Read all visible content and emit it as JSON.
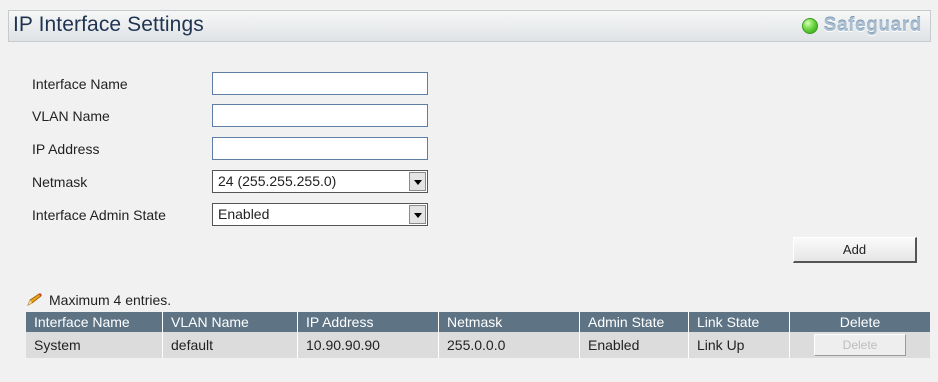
{
  "header": {
    "title": "IP Interface Settings",
    "safeguard_label": "Safeguard"
  },
  "form": {
    "interface_name": {
      "label": "Interface Name",
      "value": ""
    },
    "vlan_name": {
      "label": "VLAN Name",
      "value": ""
    },
    "ip_address": {
      "label": "IP Address",
      "value": ""
    },
    "netmask": {
      "label": "Netmask",
      "selected": "24 (255.255.255.0)"
    },
    "admin_state": {
      "label": "Interface Admin State",
      "selected": "Enabled"
    },
    "add_label": "Add"
  },
  "note": "Maximum 4 entries.",
  "table": {
    "columns": [
      "Interface Name",
      "VLAN Name",
      "IP Address",
      "Netmask",
      "Admin State",
      "Link State",
      "Delete"
    ],
    "rows": [
      {
        "interface_name": "System",
        "vlan_name": "default",
        "ip_address": "10.90.90.90",
        "netmask": "255.0.0.0",
        "admin_state": "Enabled",
        "link_state": "Link Up",
        "delete_label": "Delete"
      }
    ]
  },
  "colors": {
    "table_header_bg": "#5e7485",
    "table_row_bg": "#dcdcdc",
    "title_color": "#1f3450",
    "safeguard_indicator": "#4cc22a"
  },
  "icons": {
    "safeguard": "green-status-dot-icon",
    "note": "pencil-icon"
  }
}
